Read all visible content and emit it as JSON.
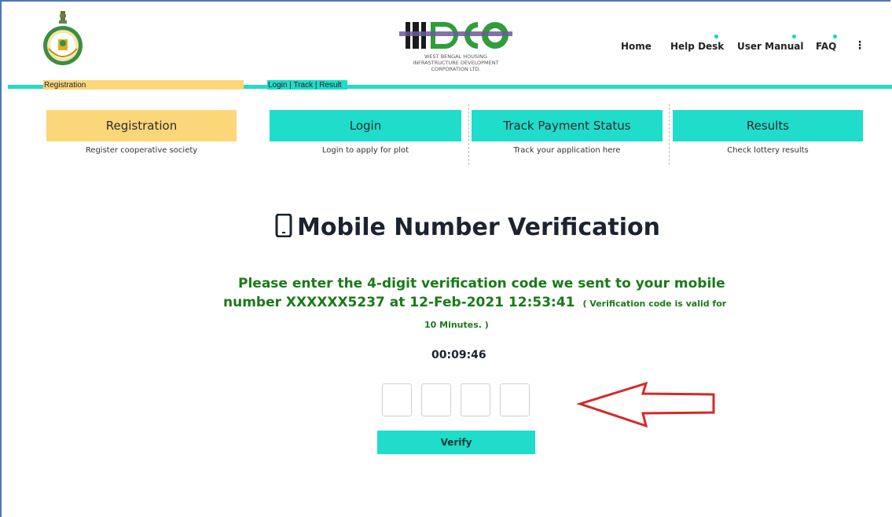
{
  "org": {
    "logo_lines": [
      "WEST BENGAL HOUSING",
      "INFRASTRUCTURE DEVELOPMENT",
      "CORPORATION LTD."
    ],
    "logo_mark": "HIDCO",
    "brand_color": "#2f9e3a"
  },
  "nav": {
    "home": "Home",
    "help_desk": "Help Desk",
    "user_manual": "User Manual",
    "faq": "FAQ",
    "more": "⋮"
  },
  "tabbar": {
    "registration": "Registration",
    "login_track_result": "Login | Track | Result"
  },
  "cards": [
    {
      "title": "Registration",
      "subtitle": "Register cooperative society",
      "color": "#fbd77a"
    },
    {
      "title": "Login",
      "subtitle": "Login to apply for plot",
      "color": "#1fdccb"
    },
    {
      "title": "Track Payment Status",
      "subtitle": "Track your application here",
      "color": "#1fdccb"
    },
    {
      "title": "Results",
      "subtitle": "Check lottery results",
      "color": "#1fdccb"
    }
  ],
  "verification": {
    "icon": "mobile-phone-icon",
    "title": "Mobile Number Verification",
    "line1": "Please enter the 4-digit verification code we sent to your mobile",
    "line2": "number XXXXXX5237 at 12-Feb-2021 12:53:41",
    "validity_part1": "( Verification code is valid for",
    "validity_part2": "10 Minutes. )",
    "timer": "00:09:46",
    "otp_values": [
      "",
      "",
      "",
      ""
    ],
    "verify_label": "Verify"
  },
  "colors": {
    "accent": "#1fdccb",
    "registration": "#fbd77a",
    "message_green": "#1a7a1a",
    "arrow_red": "#d42a2a"
  }
}
